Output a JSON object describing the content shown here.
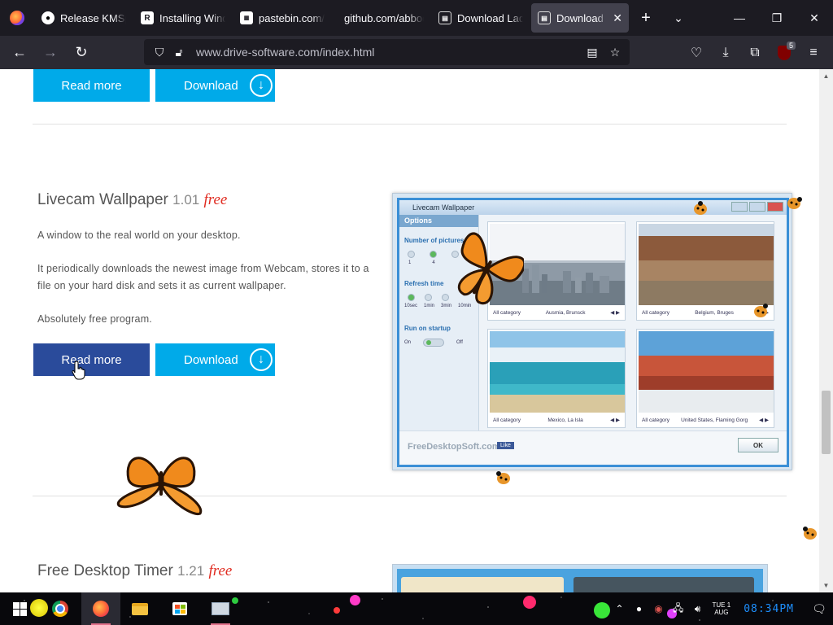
{
  "browser": {
    "tabs": [
      {
        "title": "Release KMSpico",
        "favicon": "github",
        "active": false
      },
      {
        "title": "Installing Windows",
        "favicon": "R",
        "active": false
      },
      {
        "title": "pastebin.com/",
        "favicon": "pastebin",
        "active": false
      },
      {
        "title": "github.com/abbodi",
        "favicon": "none",
        "active": false
      },
      {
        "title": "Download Ladybug",
        "favicon": "page",
        "active": false
      },
      {
        "title": "Download Livecam",
        "favicon": "page",
        "active": true
      }
    ],
    "url": "www.drive-software.com/index.html",
    "extension_badge": "5"
  },
  "page": {
    "top_buttons": {
      "read_more": "Read more",
      "download": "Download"
    },
    "product1": {
      "name": "Livecam Wallpaper",
      "version": "1.01",
      "price": "free",
      "desc1": "A window to the real world on your desktop.",
      "desc2": "It periodically downloads the newest image from Webcam, stores it to a file on your hard disk and sets it as current wallpaper.",
      "desc3": "Absolutely free program.",
      "read_more": "Read more",
      "download": "Download",
      "screenshot": {
        "window_title": "Livecam Wallpaper",
        "options_header": "Options",
        "num_pictures_label": "Number of pictures",
        "num_options": [
          "1",
          "4"
        ],
        "refresh_label": "Refresh time",
        "refresh_options": [
          "10sec",
          "1min",
          "3min",
          "10min"
        ],
        "startup_label": "Run on startup",
        "toggle_on": "On",
        "toggle_off": "Off",
        "tiles": [
          {
            "category": "All category",
            "place": "Ausmia, Brunsck"
          },
          {
            "category": "All category",
            "place": "Belgium, Bruges"
          },
          {
            "category": "All category",
            "place": "Mexico, La Isla"
          },
          {
            "category": "All category",
            "place": "United States, Flaming Gorg"
          }
        ],
        "brand": "FreeDesktopSoft.com",
        "like": "Like",
        "ok": "OK"
      }
    },
    "product2": {
      "name": "Free Desktop Timer",
      "version": "1.21",
      "price": "free"
    }
  },
  "taskbar": {
    "date_day": "TUE",
    "date_num": "1",
    "date_month": "AUG",
    "clock": "08:34PM"
  },
  "colors": {
    "button_blue": "#00aae9",
    "button_hover": "#2a4b9b",
    "free_red": "#e02b20"
  }
}
